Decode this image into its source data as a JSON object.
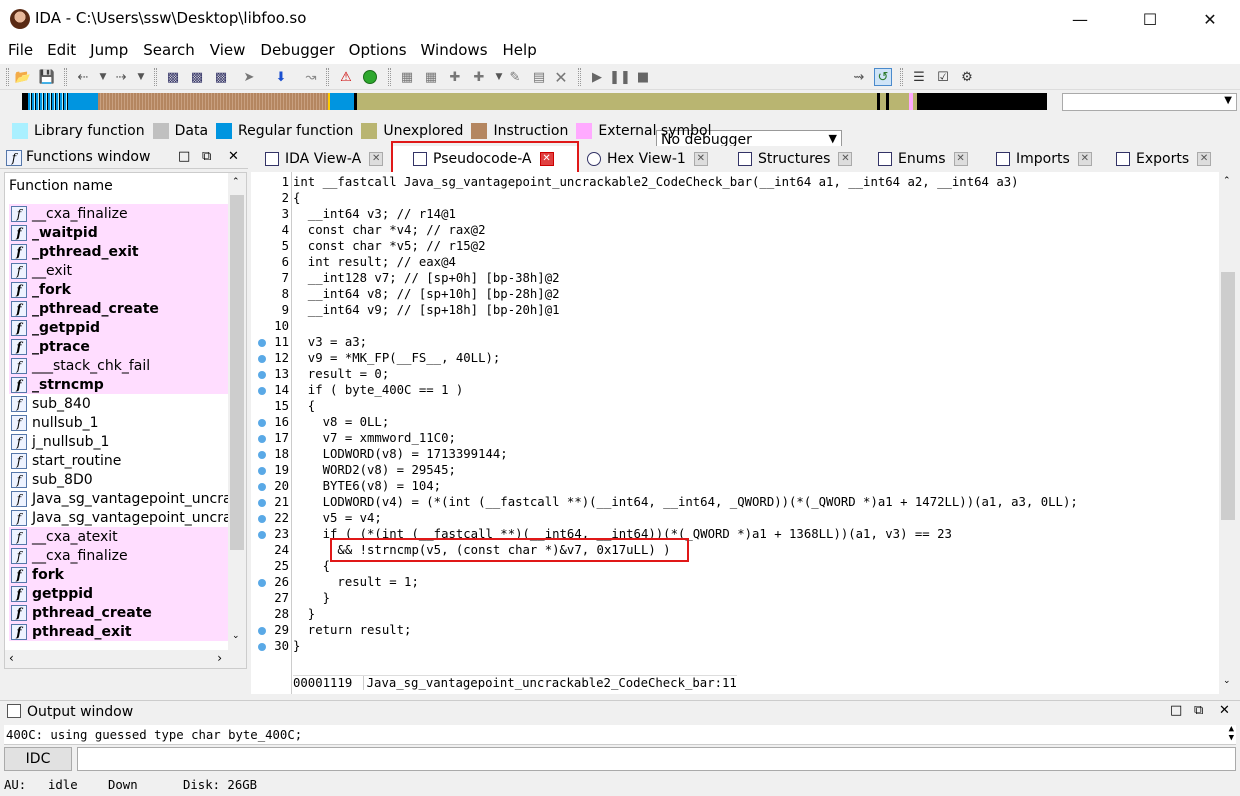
{
  "window": {
    "title": "IDA - C:\\Users\\ssw\\Desktop\\libfoo.so"
  },
  "menu": [
    "File",
    "Edit",
    "Jump",
    "Search",
    "View",
    "Debugger",
    "Options",
    "Windows",
    "Help"
  ],
  "toolbar": {
    "debugger_select": "No debugger"
  },
  "legend": [
    {
      "label": "Library function",
      "color": "#aaf0ff"
    },
    {
      "label": "Data",
      "color": "#c0c0c0"
    },
    {
      "label": "Regular function",
      "color": "#0095e0"
    },
    {
      "label": "Unexplored",
      "color": "#b9b571"
    },
    {
      "label": "Instruction",
      "color": "#b48660"
    },
    {
      "label": "External symbol",
      "color": "#ffaaff"
    }
  ],
  "functions_window": {
    "title": "Functions window",
    "column_header": "Function name",
    "items": [
      {
        "name": "__cxa_finalize",
        "lib": true,
        "bold": false
      },
      {
        "name": "_waitpid",
        "lib": true,
        "bold": true
      },
      {
        "name": "_pthread_exit",
        "lib": true,
        "bold": true
      },
      {
        "name": "__exit",
        "lib": true,
        "bold": false
      },
      {
        "name": "_fork",
        "lib": true,
        "bold": true
      },
      {
        "name": "_pthread_create",
        "lib": true,
        "bold": true
      },
      {
        "name": "_getppid",
        "lib": true,
        "bold": true
      },
      {
        "name": "_ptrace",
        "lib": true,
        "bold": true
      },
      {
        "name": "___stack_chk_fail",
        "lib": true,
        "bold": false
      },
      {
        "name": "_strncmp",
        "lib": true,
        "bold": true
      },
      {
        "name": "sub_840",
        "lib": false,
        "bold": false
      },
      {
        "name": "nullsub_1",
        "lib": false,
        "bold": false
      },
      {
        "name": "j_nullsub_1",
        "lib": false,
        "bold": false
      },
      {
        "name": "start_routine",
        "lib": false,
        "bold": false
      },
      {
        "name": "sub_8D0",
        "lib": false,
        "bold": false
      },
      {
        "name": "Java_sg_vantagepoint_uncrac",
        "lib": false,
        "bold": false
      },
      {
        "name": "Java_sg_vantagepoint_uncrac",
        "lib": false,
        "bold": false
      },
      {
        "name": "__cxa_atexit",
        "lib": true,
        "bold": false
      },
      {
        "name": "__cxa_finalize",
        "lib": true,
        "bold": false
      },
      {
        "name": "fork",
        "lib": true,
        "bold": true
      },
      {
        "name": "getppid",
        "lib": true,
        "bold": true
      },
      {
        "name": "pthread_create",
        "lib": true,
        "bold": true
      },
      {
        "name": "pthread_exit",
        "lib": true,
        "bold": true
      }
    ]
  },
  "tabs": [
    {
      "label": "IDA View-A"
    },
    {
      "label": "Pseudocode-A"
    },
    {
      "label": "Hex View-1"
    },
    {
      "label": "Structures"
    },
    {
      "label": "Enums"
    },
    {
      "label": "Imports"
    },
    {
      "label": "Exports"
    }
  ],
  "code": {
    "lines": [
      {
        "n": "1",
        "dot": false,
        "text": "int __fastcall Java_sg_vantagepoint_uncrackable2_CodeCheck_bar(__int64 a1, __int64 a2, __int64 a3)"
      },
      {
        "n": "2",
        "dot": false,
        "text": "{"
      },
      {
        "n": "3",
        "dot": false,
        "text": "  __int64 v3; // r14@1"
      },
      {
        "n": "4",
        "dot": false,
        "text": "  const char *v4; // rax@2"
      },
      {
        "n": "5",
        "dot": false,
        "text": "  const char *v5; // r15@2"
      },
      {
        "n": "6",
        "dot": false,
        "text": "  int result; // eax@4"
      },
      {
        "n": "7",
        "dot": false,
        "text": "  __int128 v7; // [sp+0h] [bp-38h]@2"
      },
      {
        "n": "8",
        "dot": false,
        "text": "  __int64 v8; // [sp+10h] [bp-28h]@2"
      },
      {
        "n": "9",
        "dot": false,
        "text": "  __int64 v9; // [sp+18h] [bp-20h]@1"
      },
      {
        "n": "10",
        "dot": false,
        "text": ""
      },
      {
        "n": "11",
        "dot": true,
        "text": "  v3 = a3;"
      },
      {
        "n": "12",
        "dot": true,
        "text": "  v9 = *MK_FP(__FS__, 40LL);"
      },
      {
        "n": "13",
        "dot": true,
        "text": "  result = 0;"
      },
      {
        "n": "14",
        "dot": true,
        "text": "  if ( byte_400C == 1 )"
      },
      {
        "n": "15",
        "dot": false,
        "text": "  {"
      },
      {
        "n": "16",
        "dot": true,
        "text": "    v8 = 0LL;"
      },
      {
        "n": "17",
        "dot": true,
        "text": "    v7 = xmmword_11C0;"
      },
      {
        "n": "18",
        "dot": true,
        "text": "    LODWORD(v8) = 1713399144;"
      },
      {
        "n": "19",
        "dot": true,
        "text": "    WORD2(v8) = 29545;"
      },
      {
        "n": "20",
        "dot": true,
        "text": "    BYTE6(v8) = 104;"
      },
      {
        "n": "21",
        "dot": true,
        "text": "    LODWORD(v4) = (*(int (__fastcall **)(__int64, __int64, _QWORD))(*(_QWORD *)a1 + 1472LL))(a1, a3, 0LL);"
      },
      {
        "n": "22",
        "dot": true,
        "text": "    v5 = v4;"
      },
      {
        "n": "23",
        "dot": true,
        "text": "    if ( (*(int (__fastcall **)(__int64, __int64))(*(_QWORD *)a1 + 1368LL))(a1, v3) == 23"
      },
      {
        "n": "24",
        "dot": false,
        "text": "      && !strncmp(v5, (const char *)&v7, 0x17uLL) )"
      },
      {
        "n": "25",
        "dot": false,
        "text": "    {"
      },
      {
        "n": "26",
        "dot": true,
        "text": "      result = 1;"
      },
      {
        "n": "27",
        "dot": false,
        "text": "    }"
      },
      {
        "n": "28",
        "dot": false,
        "text": "  }"
      },
      {
        "n": "29",
        "dot": true,
        "text": "  return result;"
      },
      {
        "n": "30",
        "dot": true,
        "text": "}"
      }
    ],
    "status_addr": "00001119",
    "status_func": "Java_sg_vantagepoint_uncrackable2_CodeCheck_bar:11"
  },
  "output_window": {
    "title": "Output window",
    "text": "400C: using guessed type char byte_400C;",
    "idc_button": "IDC"
  },
  "statusbar": {
    "au": "AU:",
    "state": "idle",
    "dir": "Down",
    "disk": "Disk: 26GB"
  }
}
